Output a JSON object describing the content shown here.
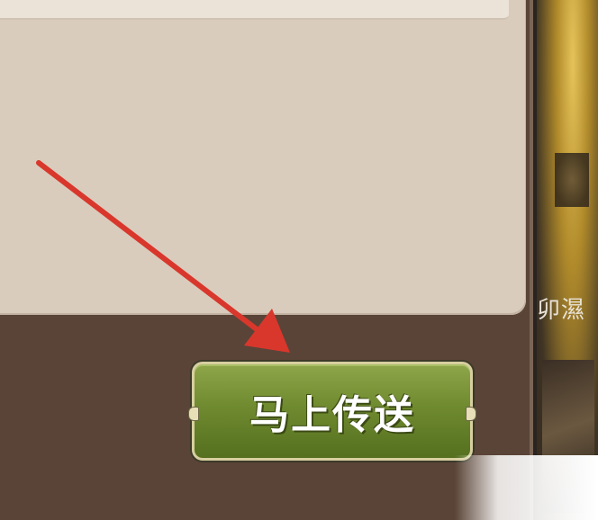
{
  "dialog": {
    "action_button_label": "马上传送"
  },
  "background": {
    "side_text": "卯濕"
  },
  "colors": {
    "panel": "#d9ccbd",
    "frame": "#5a4437",
    "button_green": "#6f8a2f",
    "arrow_red": "#d9372c"
  },
  "icons": {
    "annotation": "red-arrow-icon"
  }
}
